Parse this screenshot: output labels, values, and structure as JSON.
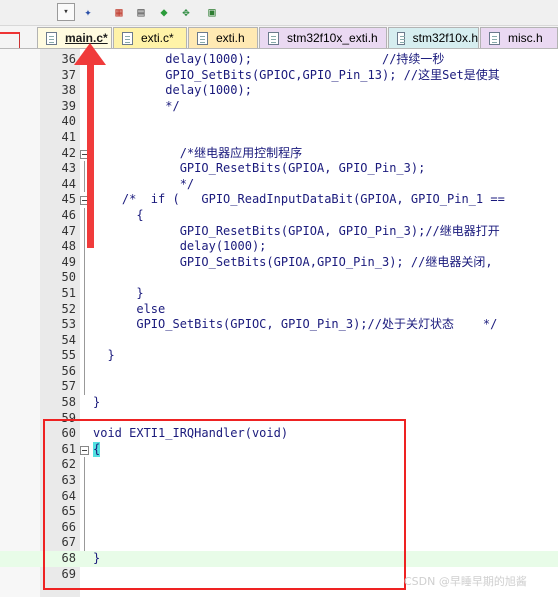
{
  "toolbar": {
    "items": [
      {
        "icon": "dropdown-arrow-icon",
        "glyph": "▾"
      },
      {
        "icon": "magic-wand-icon",
        "glyph": "✦"
      },
      {
        "icon": "build-target-icon",
        "glyph": "▦"
      },
      {
        "icon": "multi-project-icon",
        "glyph": "▤"
      },
      {
        "icon": "diamond-icon",
        "glyph": "◆"
      },
      {
        "icon": "debug-icon",
        "glyph": "✥"
      },
      {
        "icon": "pack-installer-icon",
        "glyph": "▣"
      }
    ]
  },
  "tabs": [
    {
      "label": "main.c*",
      "color": "#fffbe0",
      "active": true
    },
    {
      "label": "exti.c*",
      "color": "#fff3a8",
      "active": false
    },
    {
      "label": "exti.h",
      "color": "#ffe9b3",
      "active": false
    },
    {
      "label": "stm32f10x_exti.h",
      "color": "#ead9f2",
      "active": false
    },
    {
      "label": "stm32f10x.h",
      "color": "#d6eef0",
      "active": false
    },
    {
      "label": "misc.h",
      "color": "#ead9f2",
      "active": false
    }
  ],
  "editor": {
    "lines": [
      {
        "num": "36",
        "code": "          delay(1000);                  //持续一秒"
      },
      {
        "num": "37",
        "code": "          GPIO_SetBits(GPIOC,GPIO_Pin_13); //这里Set是使其"
      },
      {
        "num": "38",
        "code": "          delay(1000);"
      },
      {
        "num": "39",
        "code": "          */"
      },
      {
        "num": "40",
        "code": ""
      },
      {
        "num": "41",
        "code": ""
      },
      {
        "num": "42",
        "code": "            /*继电器应用控制程序",
        "fold": true
      },
      {
        "num": "43",
        "code": "            GPIO_ResetBits(GPIOA, GPIO_Pin_3);"
      },
      {
        "num": "44",
        "code": "            */"
      },
      {
        "num": "45",
        "code": "    /*  if (   GPIO_ReadInputDataBit(GPIOA, GPIO_Pin_1 ==",
        "fold": true
      },
      {
        "num": "46",
        "code": "      {"
      },
      {
        "num": "47",
        "code": "            GPIO_ResetBits(GPIOA, GPIO_Pin_3);//继电器打开"
      },
      {
        "num": "48",
        "code": "            delay(1000);"
      },
      {
        "num": "49",
        "code": "            GPIO_SetBits(GPIOA,GPIO_Pin_3); //继电器关闭,"
      },
      {
        "num": "50",
        "code": ""
      },
      {
        "num": "51",
        "code": "      }"
      },
      {
        "num": "52",
        "code": "      else"
      },
      {
        "num": "53",
        "code": "      GPIO_SetBits(GPIOC, GPIO_Pin_3);//处于关灯状态    */"
      },
      {
        "num": "54",
        "code": ""
      },
      {
        "num": "55",
        "code": "  }"
      },
      {
        "num": "56",
        "code": ""
      },
      {
        "num": "57",
        "code": ""
      },
      {
        "num": "58",
        "code": "}"
      },
      {
        "num": "59",
        "code": ""
      },
      {
        "num": "60",
        "code": "void EXTI1_IRQHandler(void)"
      },
      {
        "num": "61",
        "code": "{",
        "fold": true,
        "brace": true
      },
      {
        "num": "62",
        "code": ""
      },
      {
        "num": "63",
        "code": ""
      },
      {
        "num": "64",
        "code": ""
      },
      {
        "num": "65",
        "code": ""
      },
      {
        "num": "66",
        "code": ""
      },
      {
        "num": "67",
        "code": ""
      },
      {
        "num": "68",
        "code": "}",
        "brace": true,
        "current": true
      },
      {
        "num": "69",
        "code": ""
      }
    ]
  },
  "watermark": "CSDN @早睡早期的旭酱"
}
